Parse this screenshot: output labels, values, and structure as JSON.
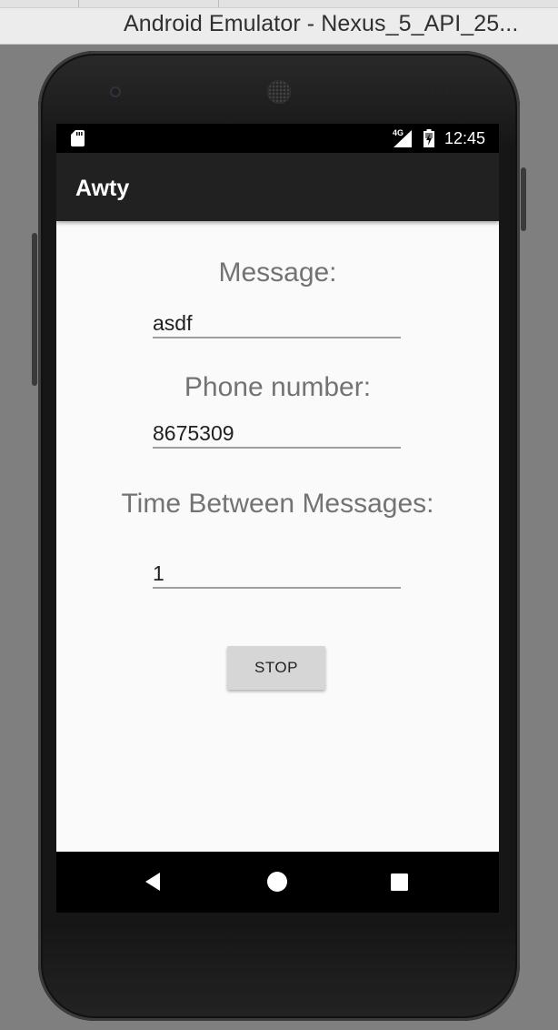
{
  "window": {
    "title": "Android Emulator - Nexus_5_API_25..."
  },
  "status_bar": {
    "network": "4G",
    "time": "12:45",
    "icons": [
      "sd-card-icon",
      "cell-signal-icon",
      "battery-charging-icon"
    ]
  },
  "app_bar": {
    "title": "Awty"
  },
  "form": {
    "message_label": "Message:",
    "message_value": "asdf",
    "phone_label": "Phone number:",
    "phone_value": "8675309",
    "interval_label": "Time Between Messages:",
    "interval_value": "1",
    "stop_button": "STOP"
  },
  "nav_bar": {
    "icons": [
      "back-icon",
      "home-icon",
      "recents-icon"
    ]
  },
  "colors": {
    "app_bar": "#212121",
    "content_bg": "#fafafa",
    "label_text": "#737373",
    "button_bg": "#d6d6d6",
    "emulator_bg": "#7f7f7f"
  }
}
